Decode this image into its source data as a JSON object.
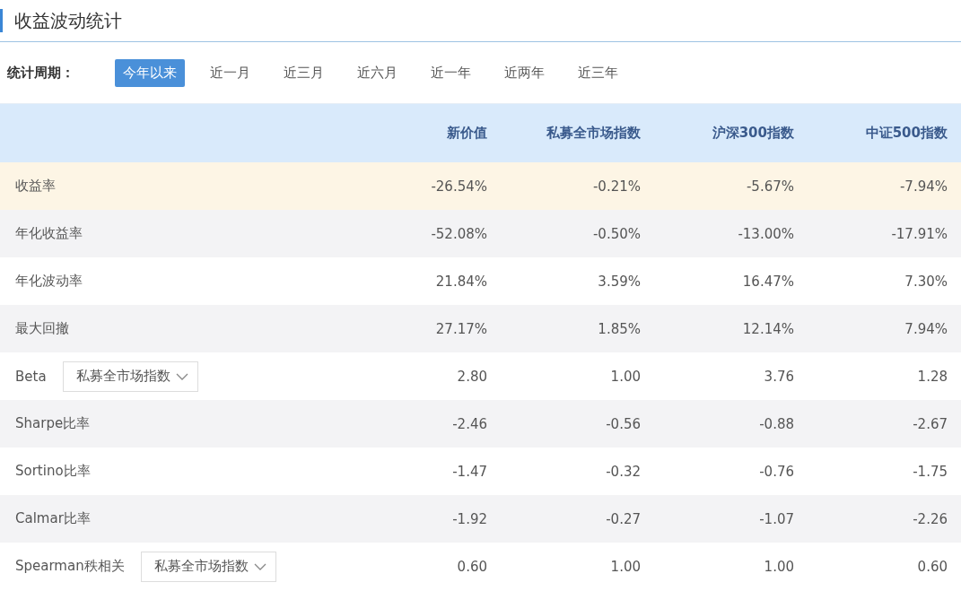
{
  "title": "收益波动统计",
  "period": {
    "label": "统计周期：",
    "options": [
      {
        "label": "今年以来",
        "selected": true
      },
      {
        "label": "近一月",
        "selected": false
      },
      {
        "label": "近三月",
        "selected": false
      },
      {
        "label": "近六月",
        "selected": false
      },
      {
        "label": "近一年",
        "selected": false
      },
      {
        "label": "近两年",
        "selected": false
      },
      {
        "label": "近三年",
        "selected": false
      }
    ]
  },
  "table": {
    "columns": [
      "新价值",
      "私募全市场指数",
      "沪深300指数",
      "中证500指数"
    ],
    "rows": [
      {
        "label": "收益率",
        "highlighted": true,
        "values": [
          "-26.54%",
          "-0.21%",
          "-5.67%",
          "-7.94%"
        ]
      },
      {
        "label": "年化收益率",
        "highlighted": false,
        "values": [
          "-52.08%",
          "-0.50%",
          "-13.00%",
          "-17.91%"
        ]
      },
      {
        "label": "年化波动率",
        "highlighted": false,
        "values": [
          "21.84%",
          "3.59%",
          "16.47%",
          "7.30%"
        ]
      },
      {
        "label": "最大回撤",
        "highlighted": false,
        "values": [
          "27.17%",
          "1.85%",
          "12.14%",
          "7.94%"
        ]
      },
      {
        "label": "Beta",
        "highlighted": false,
        "select": "私募全市场指数",
        "values": [
          "2.80",
          "1.00",
          "3.76",
          "1.28"
        ]
      },
      {
        "label": "Sharpe比率",
        "highlighted": false,
        "values": [
          "-2.46",
          "-0.56",
          "-0.88",
          "-2.67"
        ]
      },
      {
        "label": "Sortino比率",
        "highlighted": false,
        "values": [
          "-1.47",
          "-0.32",
          "-0.76",
          "-1.75"
        ]
      },
      {
        "label": "Calmar比率",
        "highlighted": false,
        "values": [
          "-1.92",
          "-0.27",
          "-1.07",
          "-2.26"
        ]
      },
      {
        "label": "Spearman秩相关",
        "highlighted": false,
        "select": "私募全市场指数",
        "values": [
          "0.60",
          "1.00",
          "1.00",
          "0.60"
        ]
      }
    ]
  }
}
